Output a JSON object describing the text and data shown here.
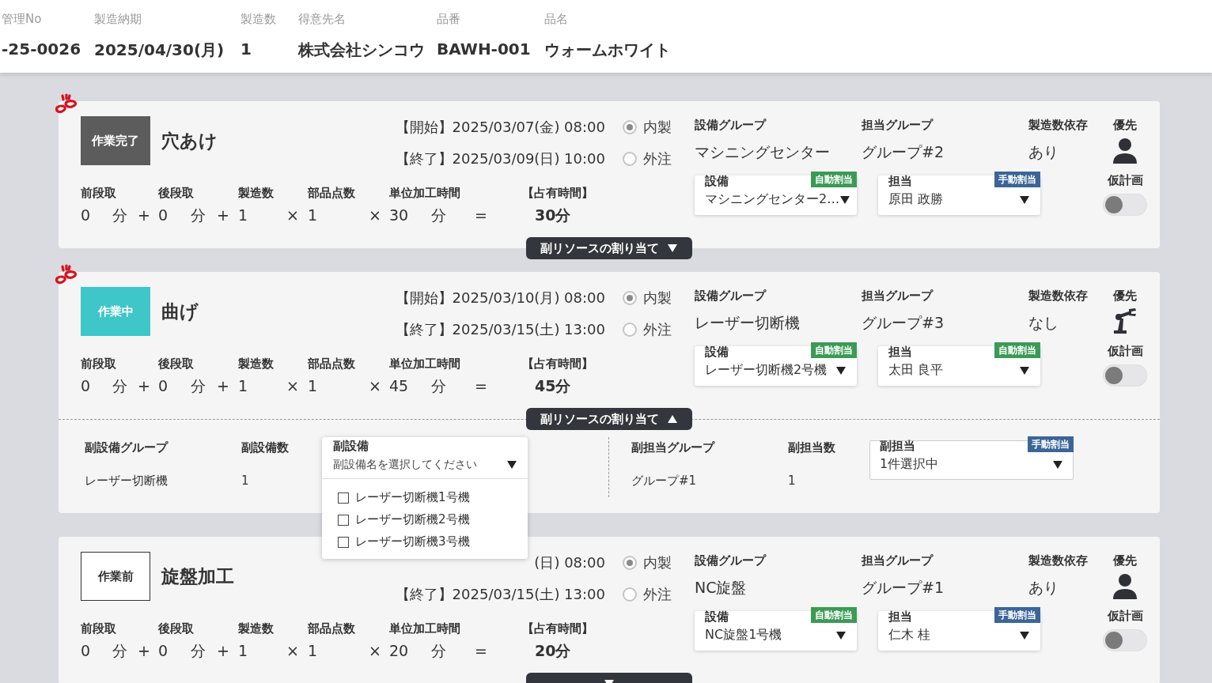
{
  "header": {
    "fields": [
      {
        "label": "管理No",
        "value": "-25-0026"
      },
      {
        "label": "製造納期",
        "value": "2025/04/30(月)"
      },
      {
        "label": "製造数",
        "value": "1"
      },
      {
        "label": "得意先名",
        "value": "株式会社シンコウ"
      },
      {
        "label": "品番",
        "value": "BAWH-001"
      },
      {
        "label": "品名",
        "value": "ウォームホワイト"
      }
    ]
  },
  "processes": [
    {
      "linked": true,
      "status": {
        "text": "作業完了",
        "kind": "done"
      },
      "title": "穴あけ",
      "start": "【開始】2025/03/07(金) 08:00",
      "end": "【終了】2025/03/09(日) 10:00",
      "sourcing": [
        {
          "label": "内製",
          "selected": true
        },
        {
          "label": "外注",
          "selected": false
        }
      ],
      "formula": [
        {
          "label": "前段取",
          "value": "0",
          "unit": "分",
          "op": "+"
        },
        {
          "label": "後段取",
          "value": "0",
          "unit": "分",
          "op": "+"
        },
        {
          "label": "製造数",
          "value": "1",
          "op": "×"
        },
        {
          "label": "部品点数",
          "value": "1",
          "op": "×"
        },
        {
          "label": "単位加工時間",
          "value": "30",
          "unit": "分",
          "op": "="
        }
      ],
      "occupied": {
        "label": "【占有時間】",
        "value": "30分"
      },
      "resources": {
        "equipment_group": {
          "label": "設備グループ",
          "value": "マシニングセンター"
        },
        "worker_group": {
          "label": "担当グループ",
          "value": "グループ#2"
        },
        "qty_dependent": {
          "label": "製造数依存",
          "value": "あり"
        },
        "priority": {
          "label": "優先",
          "kind": "person"
        },
        "selects": [
          {
            "label": "設備",
            "value": "マシニングセンター2…",
            "tag": {
              "text": "自動割当",
              "kind": "auto"
            }
          },
          {
            "label": "担当",
            "value": "原田 政勝",
            "tag": {
              "text": "手動割当",
              "kind": "manual"
            }
          }
        ],
        "tentative": {
          "label": "仮計画",
          "on": false
        }
      },
      "subresource": {
        "label": "副リソースの割り当て",
        "expanded": false
      }
    },
    {
      "linked": true,
      "status": {
        "text": "作業中",
        "kind": "in_progress"
      },
      "title": "曲げ",
      "start": "【開始】2025/03/10(月) 08:00",
      "end": "【終了】2025/03/15(土) 13:00",
      "sourcing": [
        {
          "label": "内製",
          "selected": true
        },
        {
          "label": "外注",
          "selected": false
        }
      ],
      "formula": [
        {
          "label": "前段取",
          "value": "0",
          "unit": "分",
          "op": "+"
        },
        {
          "label": "後段取",
          "value": "0",
          "unit": "分",
          "op": "+"
        },
        {
          "label": "製造数",
          "value": "1",
          "op": "×"
        },
        {
          "label": "部品点数",
          "value": "1",
          "op": "×"
        },
        {
          "label": "単位加工時間",
          "value": "45",
          "unit": "分",
          "op": "="
        }
      ],
      "occupied": {
        "label": "【占有時間】",
        "value": "45分"
      },
      "resources": {
        "equipment_group": {
          "label": "設備グループ",
          "value": "レーザー切断機"
        },
        "worker_group": {
          "label": "担当グループ",
          "value": "グループ#3"
        },
        "qty_dependent": {
          "label": "製造数依存",
          "value": "なし"
        },
        "priority": {
          "label": "優先",
          "kind": "robot"
        },
        "selects": [
          {
            "label": "設備",
            "value": "レーザー切断機2号機",
            "tag": {
              "text": "自動割当",
              "kind": "auto"
            }
          },
          {
            "label": "担当",
            "value": "太田 良平",
            "tag": {
              "text": "自動割当",
              "kind": "auto"
            }
          }
        ],
        "tentative": {
          "label": "仮計画",
          "on": false
        }
      },
      "subresource": {
        "label": "副リソースの割り当て",
        "expanded": true,
        "equipment": {
          "group_label": "副設備グループ",
          "group": "レーザー切断機",
          "count_label": "副設備数",
          "count": "1",
          "select": {
            "label": "副設備",
            "placeholder": "副設備名を選択してください",
            "open": true,
            "options": [
              {
                "label": "レーザー切断機1号機",
                "checked": false
              },
              {
                "label": "レーザー切断機2号機",
                "checked": false
              },
              {
                "label": "レーザー切断機3号機",
                "checked": false
              }
            ]
          }
        },
        "worker": {
          "group_label": "副担当グループ",
          "group": "グループ#1",
          "count_label": "副担当数",
          "count": "1",
          "select": {
            "label": "副担当",
            "value": "1件選択中",
            "tag": {
              "text": "手動割当",
              "kind": "manual"
            }
          }
        }
      }
    },
    {
      "linked": false,
      "status": {
        "text": "作業前",
        "kind": "todo"
      },
      "title": "旋盤加工",
      "start": "(日) 08:00",
      "end": "【終了】2025/03/15(土) 13:00",
      "sourcing": [
        {
          "label": "内製",
          "selected": true
        },
        {
          "label": "外注",
          "selected": false
        }
      ],
      "formula": [
        {
          "label": "前段取",
          "value": "0",
          "unit": "分",
          "op": "+"
        },
        {
          "label": "後段取",
          "value": "0",
          "unit": "分",
          "op": "+"
        },
        {
          "label": "製造数",
          "value": "1",
          "op": "×"
        },
        {
          "label": "部品点数",
          "value": "1",
          "op": "×"
        },
        {
          "label": "単位加工時間",
          "value": "20",
          "unit": "分",
          "op": "="
        }
      ],
      "occupied": {
        "label": "【占有時間】",
        "value": "20分"
      },
      "resources": {
        "equipment_group": {
          "label": "設備グループ",
          "value": "NC旋盤"
        },
        "worker_group": {
          "label": "担当グループ",
          "value": "グループ#1"
        },
        "qty_dependent": {
          "label": "製造数依存",
          "value": "あり"
        },
        "priority": {
          "label": "優先",
          "kind": "person"
        },
        "selects": [
          {
            "label": "設備",
            "value": "NC旋盤1号機",
            "tag": {
              "text": "自動割当",
              "kind": "auto"
            }
          },
          {
            "label": "担当",
            "value": "仁木 桂",
            "tag": {
              "text": "手動割当",
              "kind": "manual"
            }
          }
        ],
        "tentative": {
          "label": "仮計画",
          "on": false
        }
      }
    }
  ]
}
